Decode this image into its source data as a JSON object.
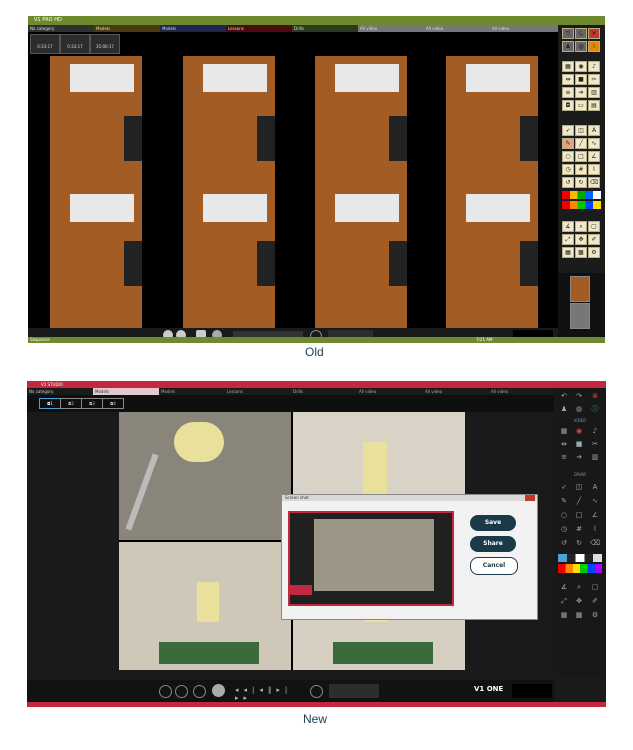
{
  "old": {
    "title": "V1 PRO HD",
    "tabs": [
      "No category",
      "Models",
      "Lessons",
      "Drills",
      "All video",
      "All video",
      "All video"
    ],
    "cameras": [
      "0:33:17",
      "0:33:17",
      "35:00:17"
    ],
    "status": "Sequence",
    "status_right": "7/21 AM",
    "caption": "Old"
  },
  "new": {
    "title": "V1 STUDIO",
    "tabs": [
      "No category",
      "Models",
      "Lessons",
      "Drills",
      "All video",
      "All video",
      "All video"
    ],
    "tools_label_a": "VIDEO",
    "tools_label_b": "DRAW",
    "brand": "V1 ONE",
    "caption": "New",
    "dialog": {
      "title": "Screen shot",
      "save": "Save",
      "share": "Share",
      "cancel": "Cancel"
    }
  },
  "colors": {
    "old_accent": "#6f8a2e",
    "new_accent": "#c2283e",
    "dialog_btn": "#1b3a47"
  }
}
